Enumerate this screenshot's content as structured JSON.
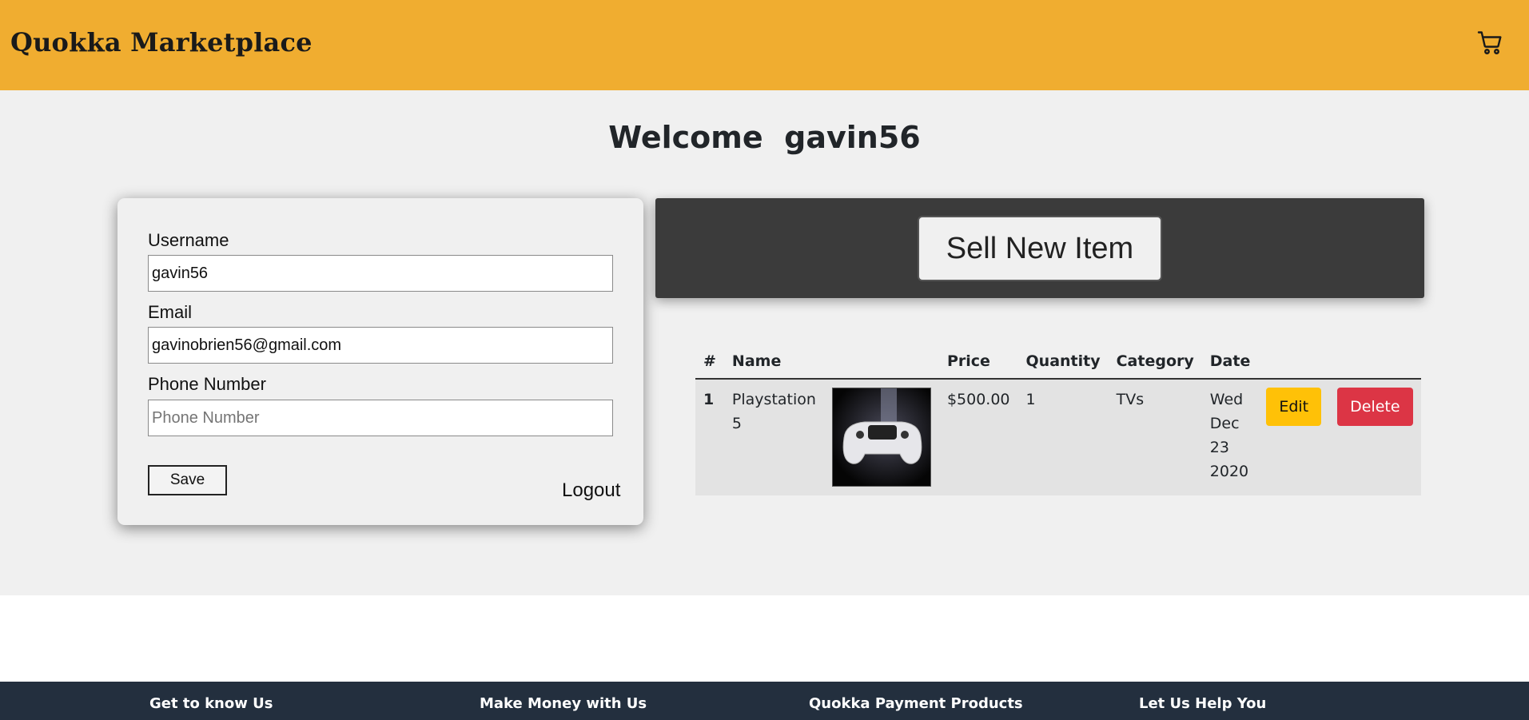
{
  "header": {
    "brand": "Quokka Marketplace",
    "cart_icon": "cart-icon",
    "bg_color": "#f0ad30"
  },
  "welcome": {
    "greeting": "Welcome",
    "username": "gavin56"
  },
  "profile": {
    "username_label": "Username",
    "username_value": "gavin56",
    "email_label": "Email",
    "email_value": "gavinobrien56@gmail.com",
    "phone_label": "Phone Number",
    "phone_value": "",
    "phone_placeholder": "Phone Number",
    "save_label": "Save",
    "logout_label": "Logout"
  },
  "sell": {
    "button_label": "Sell New Item",
    "panel_color": "#3b3b3b"
  },
  "items": {
    "columns": [
      "#",
      "Name",
      "Price",
      "Quantity",
      "Category",
      "Date"
    ],
    "rows": [
      {
        "index": "1",
        "name": "Playstation 5",
        "image_alt": "playstation-controller-image",
        "price": "$500.00",
        "quantity": "1",
        "category": "TVs",
        "date": "Wed Dec 23 2020",
        "edit_label": "Edit",
        "delete_label": "Delete"
      }
    ],
    "edit_color": "#ffc107",
    "delete_color": "#dc3545"
  },
  "footer": {
    "columns": [
      "Get to know Us",
      "Make Money with Us",
      "Quokka Payment Products",
      "Let Us Help You"
    ],
    "bg_color": "#232f3e"
  }
}
